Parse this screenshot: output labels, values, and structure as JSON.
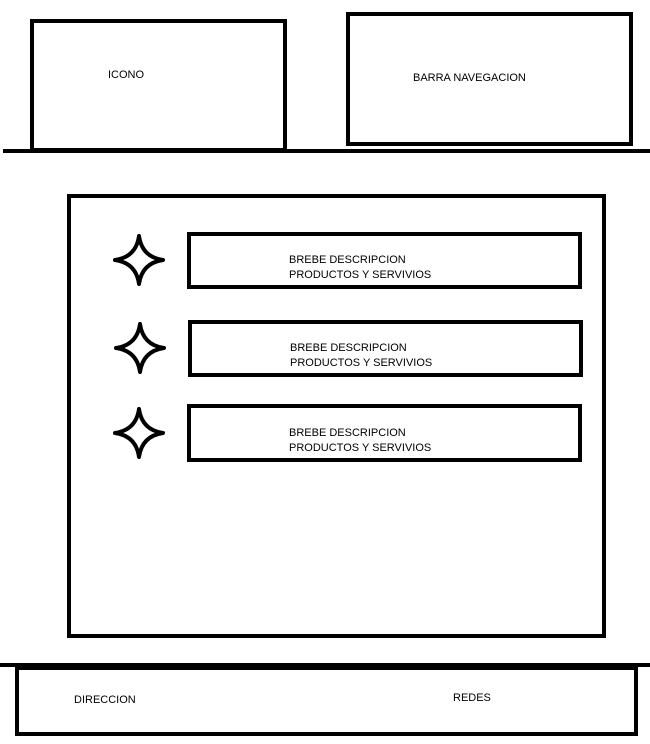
{
  "header": {
    "logo_label": "ICONO",
    "nav_label": "BARRA NAVEGACION"
  },
  "main": {
    "items": [
      {
        "icon": "star-icon",
        "line1": "BREBE DESCRIPCION",
        "line2": "PRODUCTOS Y SERVIVIOS"
      },
      {
        "icon": "star-icon",
        "line1": "BREBE DESCRIPCION",
        "line2": "PRODUCTOS Y SERVIVIOS"
      },
      {
        "icon": "star-icon",
        "line1": "BREBE DESCRIPCION",
        "line2": "PRODUCTOS Y SERVIVIOS"
      }
    ]
  },
  "footer": {
    "address_label": "DIRECCION",
    "social_label": "REDES"
  }
}
